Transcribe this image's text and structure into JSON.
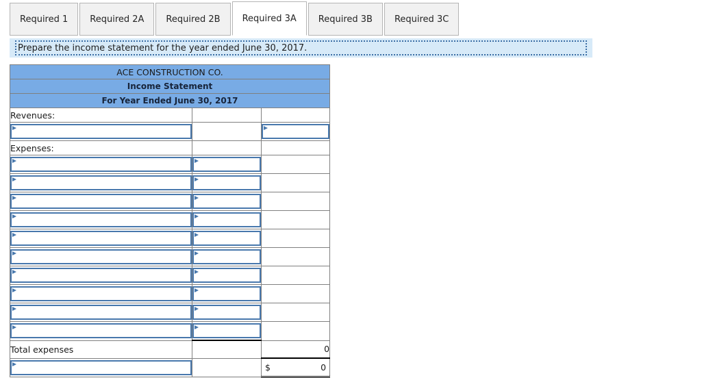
{
  "tabs": [
    {
      "label": "Required 1",
      "active": false
    },
    {
      "label": "Required 2A",
      "active": false
    },
    {
      "label": "Required 2B",
      "active": false
    },
    {
      "label": "Required 3A",
      "active": true
    },
    {
      "label": "Required 3B",
      "active": false
    },
    {
      "label": "Required 3C",
      "active": false
    }
  ],
  "instruction": {
    "text": "Prepare the income statement for the year ended June 30, 2017."
  },
  "sheet": {
    "company": "ACE CONSTRUCTION CO.",
    "statement": "Income Statement",
    "period": "For Year Ended June 30, 2017",
    "revenues_label": "Revenues:",
    "expenses_label": "Expenses:",
    "total_expenses_label": "Total expenses",
    "total_expenses_value": "0",
    "net_income_currency": "$",
    "net_income_value": "0",
    "blank_rows": [
      {
        "label": "",
        "sub": "",
        "total": ""
      },
      {
        "label": "",
        "sub": "",
        "total": ""
      },
      {
        "label": "",
        "sub": "",
        "total": ""
      },
      {
        "label": "",
        "sub": "",
        "total": ""
      },
      {
        "label": "",
        "sub": "",
        "total": ""
      },
      {
        "label": "",
        "sub": "",
        "total": ""
      },
      {
        "label": "",
        "sub": "",
        "total": ""
      },
      {
        "label": "",
        "sub": "",
        "total": ""
      },
      {
        "label": "",
        "sub": "",
        "total": ""
      },
      {
        "label": "",
        "sub": "",
        "total": ""
      }
    ],
    "revenue_entry": {
      "label": "",
      "total": ""
    },
    "net_income_entry_label": ""
  },
  "colors": {
    "header_blue": "#78abe5",
    "input_border": "#4878ad",
    "instruction_bg": "#d7eaf8",
    "tab_bg": "#f1f1f1",
    "grid": "#808080"
  }
}
